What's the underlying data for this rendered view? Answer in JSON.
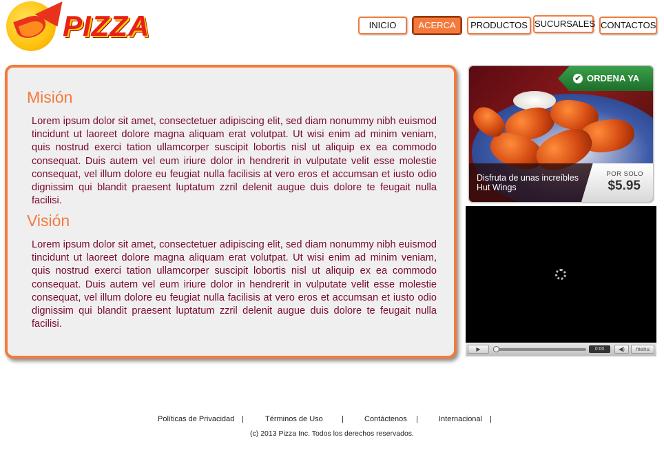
{
  "brand": {
    "logo_text": "PIZZA"
  },
  "nav": {
    "items": [
      {
        "label": "INICIO"
      },
      {
        "label": "ACERCA"
      },
      {
        "label": "PRODUCTOS"
      },
      {
        "label": "SUCURSALES"
      },
      {
        "label": "CONTACTOS"
      }
    ],
    "active": "ACERCA",
    "accent_color": "#f47a3c"
  },
  "main": {
    "mission": {
      "title": "Misión",
      "body": "Lorem ipsum dolor sit amet, consectetuer adipiscing elit, sed diam nonummy nibh euismod tincidunt ut laoreet dolore magna aliquam erat volutpat. Ut wisi enim ad minim veniam, quis nostrud exerci tation ullamcorper suscipit lobortis nisl ut aliquip ex ea commodo consequat. Duis autem vel eum iriure dolor in hendrerit in vulputate velit esse molestie consequat, vel illum dolore eu feugiat nulla facilisis at vero eros et accumsan et iusto odio dignissim qui blandit praesent luptatum zzril delenit augue duis dolore te feugait nulla facilisi."
    },
    "vision": {
      "title": "Visión",
      "body": "Lorem ipsum dolor sit amet, consectetuer adipiscing elit, sed diam nonummy nibh euismod tincidunt ut laoreet dolore magna aliquam erat volutpat. Ut wisi enim ad minim veniam, quis nostrud exerci tation ullamcorper suscipit lobortis nisl ut aliquip ex ea commodo consequat. Duis autem vel eum iriure dolor in hendrerit in vulputate velit esse molestie consequat, vel illum dolore eu feugiat nulla facilisis at vero eros et accumsan et iusto odio dignissim qui blandit praesent luptatum zzril delenit augue duis dolore te feugait nulla facilisi."
    },
    "title_color": "#f47a3c",
    "text_color": "#7a0a2c"
  },
  "promo": {
    "order_label": "ORDENA YA",
    "caption": "Disfruta de unas increíbles Hut Wings",
    "price_label": "POR SOLO",
    "price": "$5.95"
  },
  "video": {
    "time": "0:00",
    "menu_label": "menu"
  },
  "footer": {
    "links": [
      "Políticas de Privacidad",
      "Términos de Uso",
      "Contáctenos",
      "Internacional"
    ],
    "separator": "|",
    "copyright": "(c) 2013 Pizza Inc. Todos los derechos reservados."
  }
}
